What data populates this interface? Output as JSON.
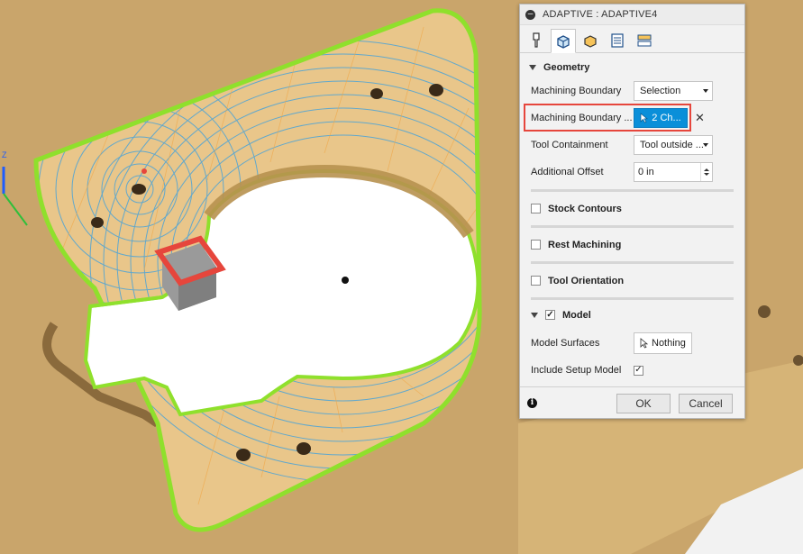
{
  "dialog": {
    "title": "ADAPTIVE : ADAPTIVE4",
    "tabs": [
      "tool-tab-icon",
      "geometry-tab-icon",
      "heights-tab-icon",
      "passes-tab-icon",
      "linking-tab-icon"
    ],
    "geometry": {
      "header": "Geometry",
      "machining_boundary_label": "Machining Boundary",
      "machining_boundary_value": "Selection",
      "boundary_selection_label": "Machining Boundary ...",
      "boundary_selection_value": "2 Ch...",
      "tool_containment_label": "Tool Containment",
      "tool_containment_value": "Tool outside ...",
      "additional_offset_label": "Additional Offset",
      "additional_offset_value": "0 in"
    },
    "stock_contours": "Stock Contours",
    "rest_machining": "Rest Machining",
    "tool_orientation": "Tool Orientation",
    "model": {
      "header": "Model",
      "model_surfaces_label": "Model Surfaces",
      "model_surfaces_value": "Nothing",
      "include_setup_label": "Include Setup Model",
      "include_setup_checked": true
    },
    "ok_label": "OK",
    "cancel_label": "Cancel"
  },
  "colors": {
    "background_wood": "#c9a56b",
    "part_top": "#e9c68a",
    "toolpath_blue": "#4aa3d8",
    "boundary_green": "#8fe02c",
    "selection_blue": "#0a8fd9",
    "highlight_red": "#e6463c"
  }
}
